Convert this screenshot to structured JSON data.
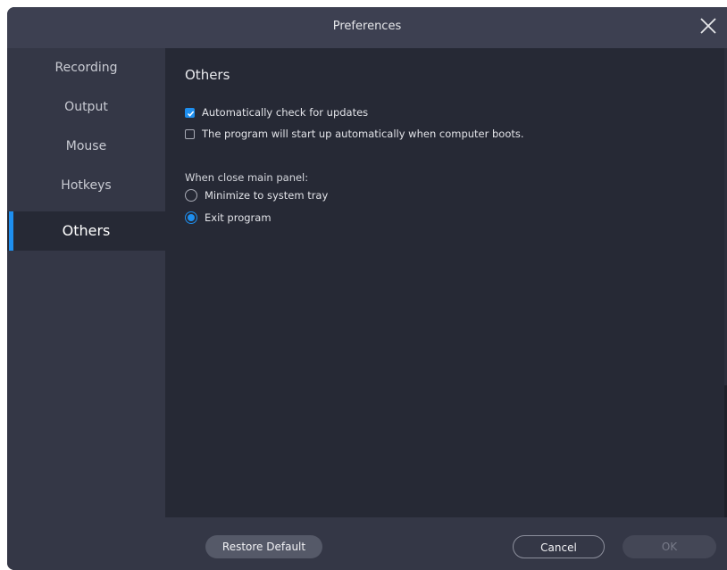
{
  "window": {
    "title": "Preferences",
    "close_icon": "close-icon"
  },
  "sidebar": {
    "items": [
      {
        "label": "Recording",
        "active": false
      },
      {
        "label": "Output",
        "active": false
      },
      {
        "label": "Mouse",
        "active": false
      },
      {
        "label": "Hotkeys",
        "active": false
      },
      {
        "label": "Others",
        "active": true
      }
    ]
  },
  "main": {
    "section_title": "Others",
    "options": [
      {
        "label": "Automatically check for updates",
        "checked": true
      },
      {
        "label": "The program will start up automatically when computer boots.",
        "checked": false
      }
    ],
    "close_group": {
      "label": "When close main panel:",
      "choices": [
        {
          "label": "Minimize to system tray",
          "selected": false
        },
        {
          "label": "Exit program",
          "selected": true
        }
      ]
    }
  },
  "footer": {
    "restore_label": "Restore Default",
    "cancel_label": "Cancel",
    "ok_label": "OK"
  },
  "colors": {
    "accent": "#1e8fef",
    "sidebar_bg": "#343746",
    "content_bg": "#262935",
    "titlebar_bg": "#3d4051"
  }
}
